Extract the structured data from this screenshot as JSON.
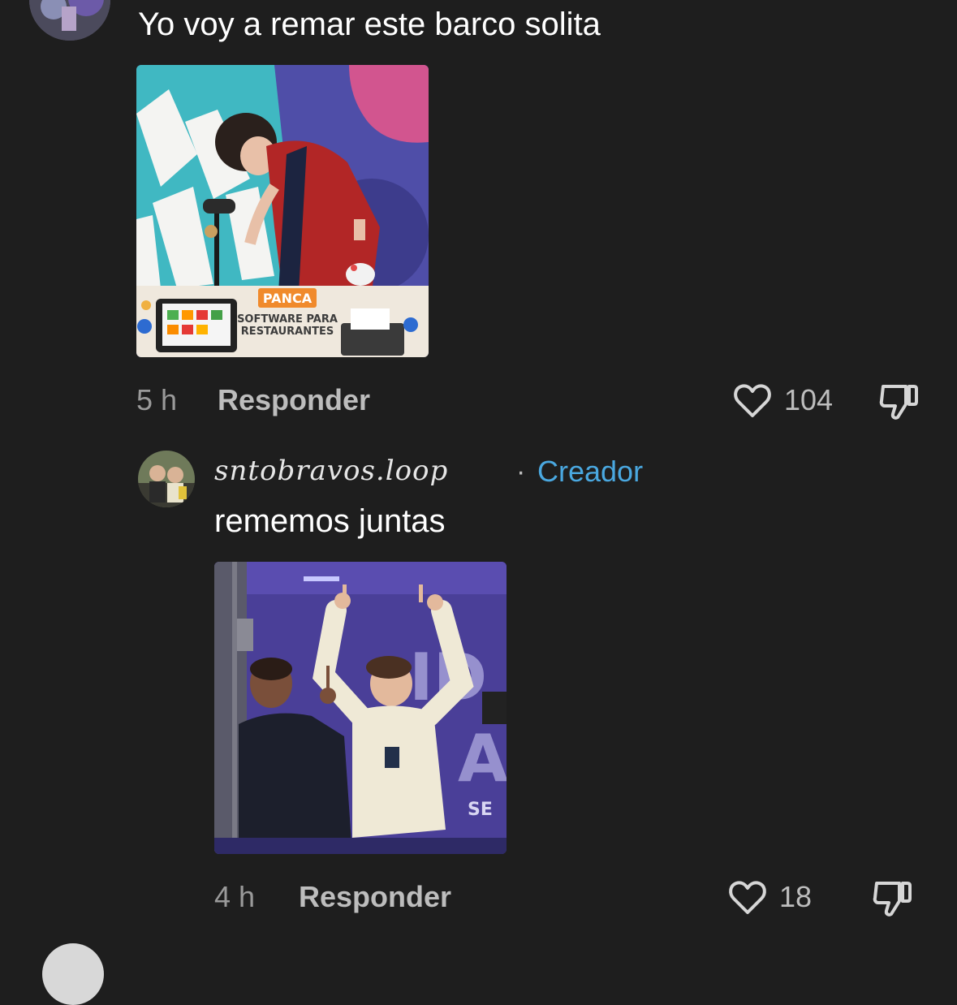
{
  "comments": [
    {
      "text": "Yo voy a remar este barco solita",
      "media": {
        "banner_brand": "PANCA",
        "banner_line1": "SOFTWARE PARA",
        "banner_line2": "RESTAURANTES"
      },
      "time": "5 h",
      "reply_label": "Responder",
      "likes": "104"
    },
    {
      "username": "sntobravos.loop",
      "separator": "·",
      "creator_badge": "Creador",
      "text": "rememos juntas",
      "media": {
        "sign_text": "SE"
      },
      "time": "4 h",
      "reply_label": "Responder",
      "likes": "18"
    }
  ],
  "colors": {
    "background": "#1e1e1e",
    "creator": "#4aa8e0",
    "secondary_text": "#9a9a9a"
  }
}
